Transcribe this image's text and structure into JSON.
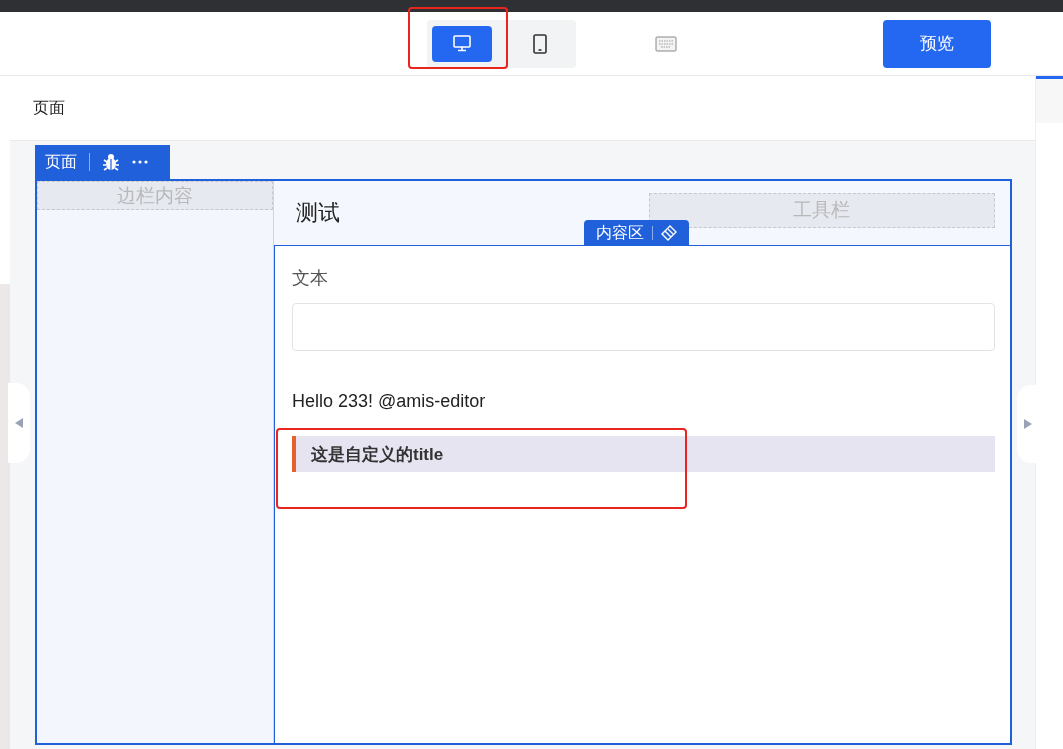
{
  "toolbar": {
    "devices": [
      {
        "kind": "desktop",
        "selected": true
      },
      {
        "kind": "tablet",
        "selected": false
      }
    ],
    "preview_button": "预览"
  },
  "page_header": {
    "title": "页面"
  },
  "page_tag": {
    "label": "页面"
  },
  "sidebar": {
    "placeholder": "边栏内容"
  },
  "header": {
    "title": "测试",
    "toolbar_placeholder": "工具栏"
  },
  "content_tag": {
    "label": "内容区"
  },
  "content": {
    "field_label": "文本",
    "text": "Hello 233! @amis-editor",
    "custom_title": "这是自定义的title"
  },
  "right_panel": {
    "tab_selected": true
  }
}
